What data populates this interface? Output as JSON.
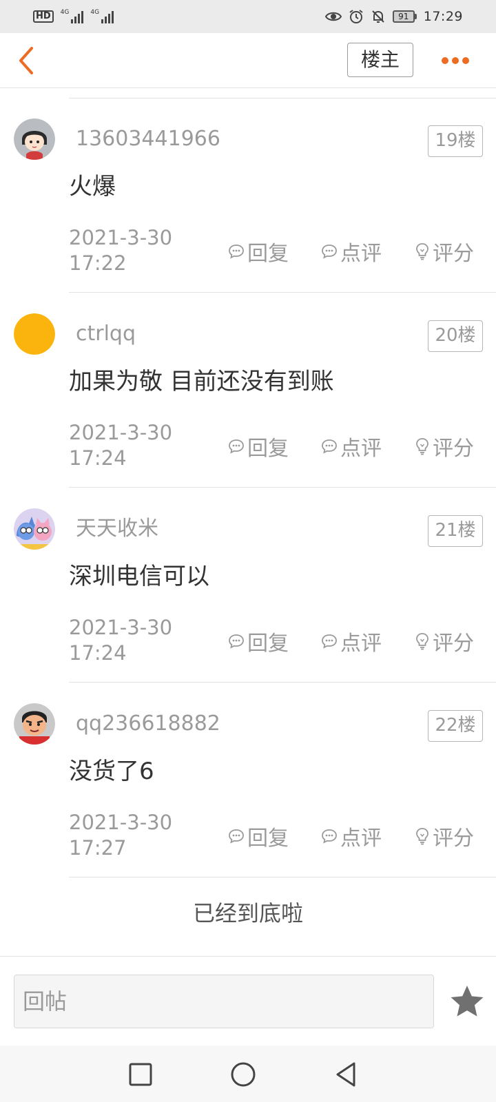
{
  "status_bar": {
    "hd": "HD",
    "net1": "4G",
    "net2": "4G",
    "battery": "91",
    "time": "17:29"
  },
  "header": {
    "back_icon": "chevron-left-icon",
    "host_button_label": "楼主",
    "more_icon": "more-dots-icon",
    "accent_color": "#ee6c22"
  },
  "posts": [
    {
      "username": "13603441966",
      "floor": "19楼",
      "content": "火爆",
      "date": "2021-3-30",
      "time": "17:22",
      "avatar": "cartoon-girl-avatar"
    },
    {
      "username": "ctrlqq",
      "floor": "20楼",
      "content": "加果为敬 目前还没有到账",
      "date": "2021-3-30",
      "time": "17:24",
      "avatar": "orange-circle-avatar"
    },
    {
      "username": "天天收米",
      "floor": "21楼",
      "content": "深圳电信可以",
      "date": "2021-3-30",
      "time": "17:24",
      "avatar": "cartoon-cats-avatar"
    },
    {
      "username": "qq236618882",
      "floor": "22楼",
      "content": "没货了6",
      "date": "2021-3-30",
      "time": "17:27",
      "avatar": "cartoon-face-avatar"
    }
  ],
  "actions": {
    "reply": "回复",
    "comment": "点评",
    "rate": "评分"
  },
  "end_text": "已经到底啦",
  "input_bar": {
    "placeholder": "回帖",
    "star_icon": "star-icon"
  },
  "system_nav": {
    "recents_icon": "square-icon",
    "home_icon": "circle-icon",
    "back_icon": "triangle-back-icon"
  }
}
